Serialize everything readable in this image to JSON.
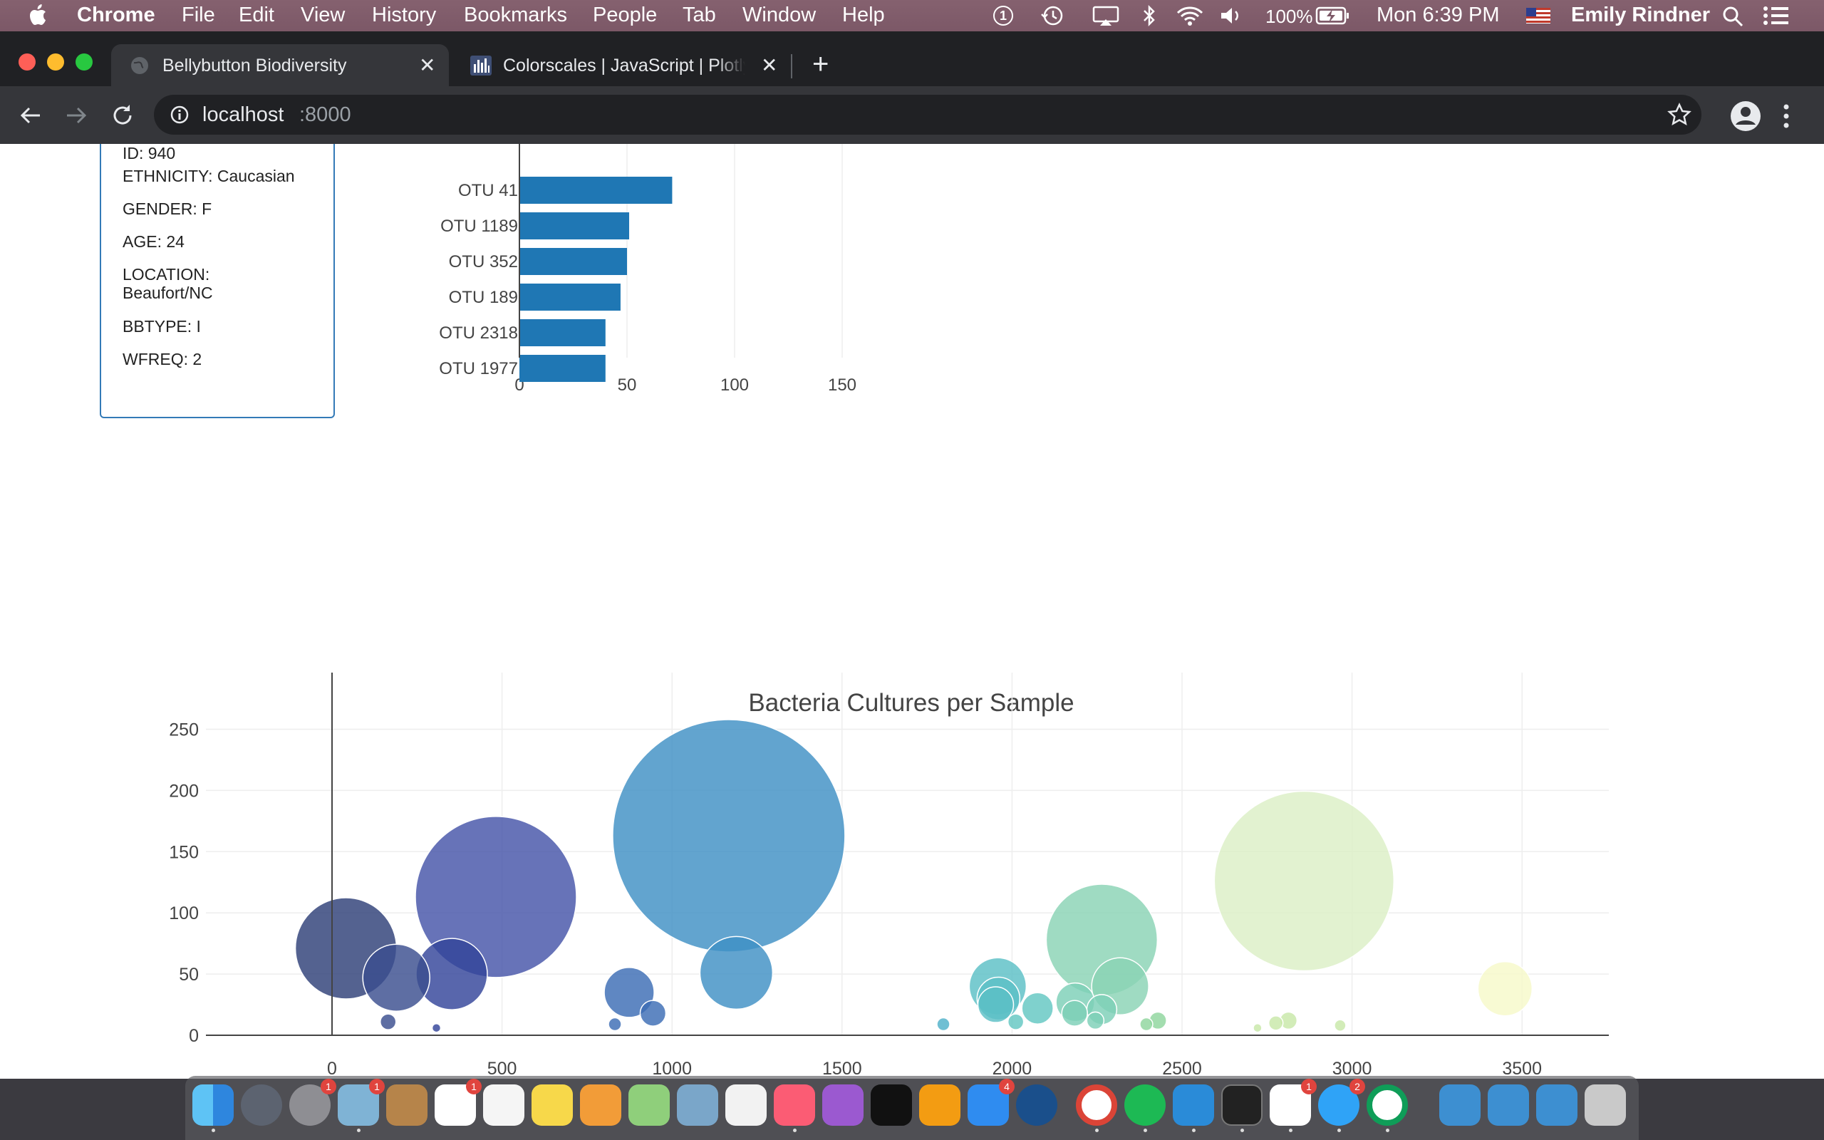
{
  "menubar": {
    "app": "Chrome",
    "items": [
      "File",
      "Edit",
      "View",
      "History",
      "Bookmarks",
      "People",
      "Tab",
      "Window",
      "Help"
    ],
    "battery": "100%",
    "clock": "Mon 6:39 PM",
    "user": "Emily Rindner"
  },
  "browser": {
    "tabs": [
      {
        "title": "Bellybutton Biodiversity",
        "active": true
      },
      {
        "title": "Colorscales | JavaScript | Plotly",
        "active": false
      }
    ],
    "new_tab": "+",
    "url_host": "localhost",
    "url_port": ":8000"
  },
  "metadata_panel": {
    "lines": [
      {
        "text": "ID: 940"
      },
      {
        "text": "ETHNICITY: Caucasian"
      },
      {
        "text": "GENDER: F"
      },
      {
        "text": "AGE: 24"
      },
      {
        "text": "LOCATION:"
      },
      {
        "text": "Beaufort/NC"
      },
      {
        "text": "BBTYPE: I"
      },
      {
        "text": "WFREQ: 2"
      }
    ]
  },
  "chart_data": [
    {
      "type": "bar",
      "orientation": "horizontal",
      "title": "",
      "categories": [
        "OTU 41",
        "OTU 1189",
        "OTU 352",
        "OTU 189",
        "OTU 2318",
        "OTU 1977"
      ],
      "values": [
        71,
        51,
        50,
        47,
        40,
        40
      ],
      "xlim": [
        0,
        160
      ],
      "xticks": [
        "0",
        "50",
        "100",
        "150"
      ],
      "color": "#1f77b4"
    },
    {
      "type": "scatter",
      "subtype": "bubble",
      "title": "Bacteria Cultures per Sample",
      "xlim": [
        -370,
        3750
      ],
      "ylim": [
        -10,
        285
      ],
      "xticks": [
        "0",
        "500",
        "1000",
        "1500",
        "2000",
        "2500",
        "3000",
        "3500"
      ],
      "yticks": [
        "0",
        "50",
        "100",
        "150",
        "200",
        "250"
      ],
      "grid": true,
      "colorscale": "Earth-like (navy → blue → teal → green → pale yellow)",
      "points": [
        {
          "x": 41,
          "y": 71,
          "color": "#2e3f78"
        },
        {
          "x": 189,
          "y": 47,
          "color": "#3a4e8f"
        },
        {
          "x": 352,
          "y": 50,
          "color": "#33449a"
        },
        {
          "x": 482,
          "y": 113,
          "color": "#4654a8"
        },
        {
          "x": 165,
          "y": 11,
          "color": "#3a4e8f"
        },
        {
          "x": 307,
          "y": 6,
          "color": "#33449a"
        },
        {
          "x": 874,
          "y": 35,
          "color": "#3c6db4"
        },
        {
          "x": 944,
          "y": 18,
          "color": "#3c6db4"
        },
        {
          "x": 832,
          "y": 9,
          "color": "#3c6db4"
        },
        {
          "x": 1167,
          "y": 163,
          "color": "#3f90c4"
        },
        {
          "x": 1189,
          "y": 51,
          "color": "#3f90c4"
        },
        {
          "x": 1798,
          "y": 9,
          "color": "#4fb1c9"
        },
        {
          "x": 1958,
          "y": 40,
          "color": "#5bbfc6"
        },
        {
          "x": 1960,
          "y": 30,
          "color": "#5bbfc6"
        },
        {
          "x": 1952,
          "y": 25,
          "color": "#5bbfc6"
        },
        {
          "x": 2075,
          "y": 22,
          "color": "#63c7c2"
        },
        {
          "x": 2011,
          "y": 11,
          "color": "#63c7c2"
        },
        {
          "x": 2264,
          "y": 78,
          "color": "#8ad3b4"
        },
        {
          "x": 2318,
          "y": 40,
          "color": "#8ad3b4"
        },
        {
          "x": 2186,
          "y": 27,
          "color": "#7ccfb7"
        },
        {
          "x": 2264,
          "y": 21,
          "color": "#7ccfb7"
        },
        {
          "x": 2184,
          "y": 18,
          "color": "#7ccfb7"
        },
        {
          "x": 2245,
          "y": 12,
          "color": "#7ccfb7"
        },
        {
          "x": 2429,
          "y": 12,
          "color": "#8fd69d"
        },
        {
          "x": 2395,
          "y": 9,
          "color": "#8fd69d"
        },
        {
          "x": 2859,
          "y": 126,
          "color": "#dcefc6"
        },
        {
          "x": 2813,
          "y": 12,
          "color": "#c8e8a8"
        },
        {
          "x": 2776,
          "y": 10,
          "color": "#c8e8a8"
        },
        {
          "x": 2965,
          "y": 8,
          "color": "#c8e8a8"
        },
        {
          "x": 2722,
          "y": 6,
          "color": "#c8e8a8"
        },
        {
          "x": 3450,
          "y": 38,
          "color": "#f6f9c9"
        }
      ]
    }
  ]
}
